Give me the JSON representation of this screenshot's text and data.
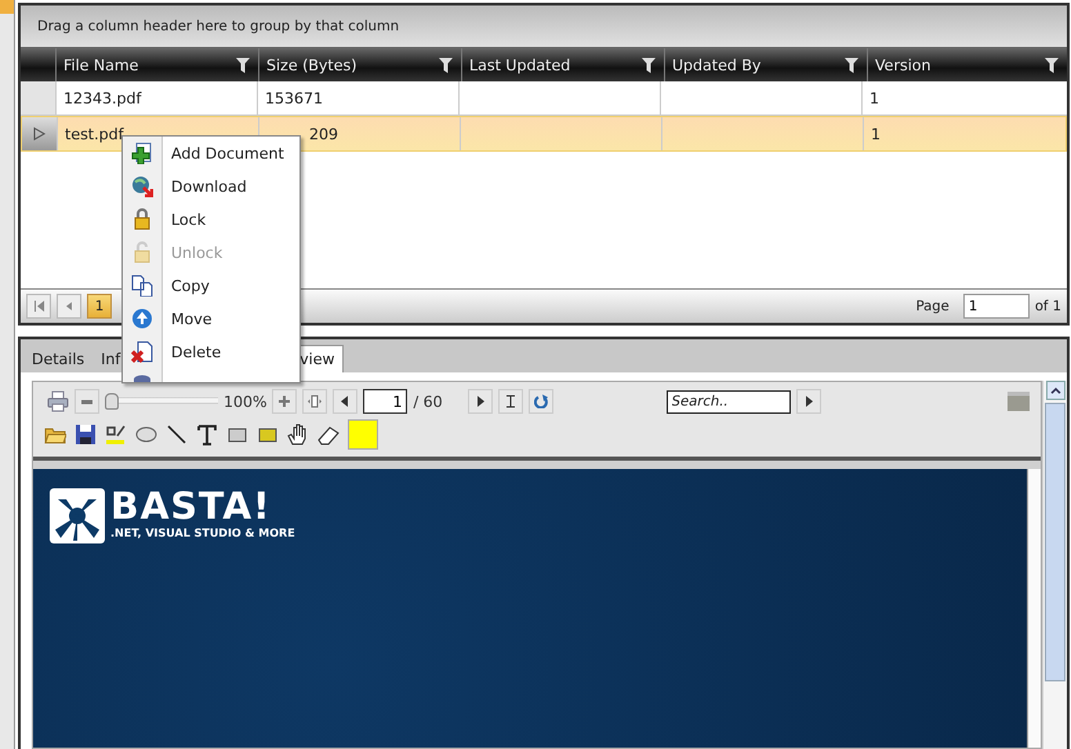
{
  "grid": {
    "group_hint": "Drag a column header here to group by that column",
    "columns": [
      {
        "label": "File Name"
      },
      {
        "label": "Size (Bytes)"
      },
      {
        "label": "Last Updated"
      },
      {
        "label": "Updated By"
      },
      {
        "label": "Version"
      }
    ],
    "rows": [
      {
        "file_name": "12343.pdf",
        "size": "153671",
        "version": "1",
        "selected": false
      },
      {
        "file_name": "test.pdf",
        "size": "209",
        "version": "1",
        "selected": true
      }
    ],
    "pager": {
      "current": "1",
      "page_label": "Page",
      "page_value": "1",
      "of_label": "of 1"
    }
  },
  "context_menu": {
    "items": [
      {
        "kind": "add",
        "label": "Add Document",
        "disabled": false
      },
      {
        "kind": "download",
        "label": "Download",
        "disabled": false
      },
      {
        "kind": "lock",
        "label": "Lock",
        "disabled": false
      },
      {
        "kind": "unlock",
        "label": "Unlock",
        "disabled": true
      },
      {
        "kind": "copy",
        "label": "Copy",
        "disabled": false
      },
      {
        "kind": "move",
        "label": "Move",
        "disabled": false
      },
      {
        "kind": "delete",
        "label": "Delete",
        "disabled": false
      },
      {
        "kind": "trash",
        "disabled": false
      }
    ]
  },
  "tabs": [
    {
      "label": "Details",
      "selected": false
    },
    {
      "label": "Inf",
      "selected": false
    },
    {
      "label": "view",
      "selected": true
    }
  ],
  "viewer": {
    "zoom": "100%",
    "zoom_slider": {
      "level": 0.05
    },
    "page": "1",
    "page_count": "/ 60",
    "search_placeholder": "Search..",
    "document": {
      "logo": "BASTA!",
      "tagline": ".NET, VISUAL STUDIO & MORE"
    }
  }
}
